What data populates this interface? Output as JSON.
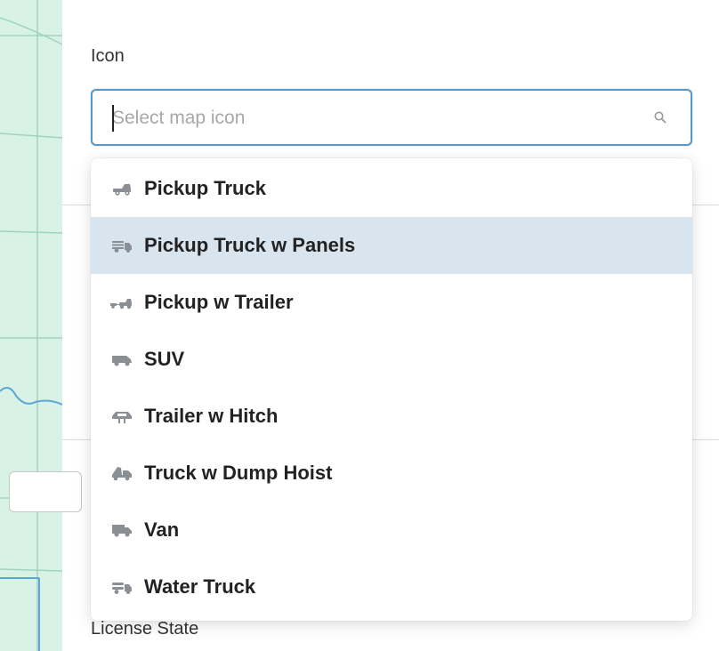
{
  "form": {
    "icon_label": "Icon",
    "license_state_label": "License State"
  },
  "select": {
    "placeholder": "Select map icon",
    "value": "",
    "search_icon": "search-icon"
  },
  "options": [
    {
      "label": "Pickup Truck",
      "icon": "pickup-truck-icon"
    },
    {
      "label": "Pickup Truck w Panels",
      "icon": "pickup-truck-panels-icon",
      "highlighted": true
    },
    {
      "label": "Pickup w Trailer",
      "icon": "pickup-trailer-icon"
    },
    {
      "label": "SUV",
      "icon": "suv-icon"
    },
    {
      "label": "Trailer w Hitch",
      "icon": "trailer-hitch-icon"
    },
    {
      "label": "Truck w Dump Hoist",
      "icon": "dump-truck-icon"
    },
    {
      "label": "Van",
      "icon": "van-icon"
    },
    {
      "label": "Water Truck",
      "icon": "water-truck-icon"
    }
  ],
  "colors": {
    "focus_border": "#5d97c6",
    "highlight_bg": "#d8e4ee",
    "map_bg": "#d8f3e6",
    "icon_color": "#8a8f96"
  }
}
